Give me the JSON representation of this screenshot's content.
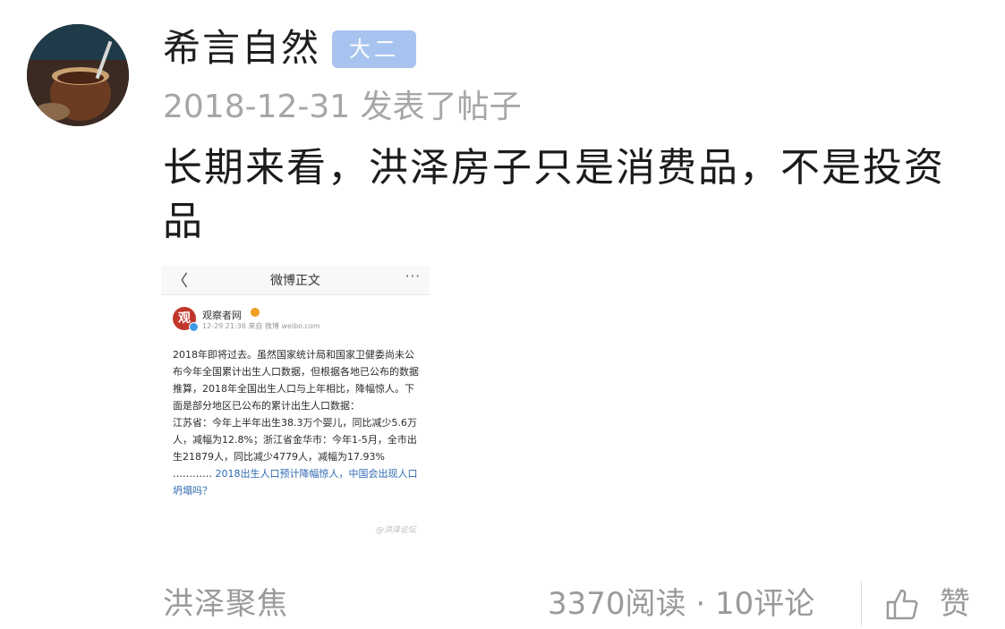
{
  "post": {
    "author": "希言自然",
    "badge": "大二",
    "meta": "2018-12-31 发表了帖子",
    "title": "长期来看，洪泽房子只是消费品，不是投资品"
  },
  "screenshot": {
    "header_title": "微博正文",
    "back_glyph": "〈",
    "more_glyph": "···",
    "account_logo_text": "观",
    "account_name": "观察者网",
    "account_time": "12-29 21:36 来自 微博 weibo.com",
    "body_text": "2018年即将过去。虽然国家统计局和国家卫健委尚未公布今年全国累计出生人口数据，但根据各地已公布的数据推算，2018年全国出生人口与上年相比，降幅惊人。下面是部分地区已公布的累计出生人口数据：",
    "body_text_2": "江苏省：今年上半年出生38.3万个婴儿，同比减少5.6万人，减幅为12.8%；浙江省金华市：今年1-5月，全市出生21879人，同比减少4779人，减幅为17.93%",
    "ellipsis": "…………",
    "link_text": "2018出生人口预计降幅惊人，中国会出现人口坍塌吗？",
    "watermark": "@洪泽论坛"
  },
  "footer": {
    "forum": "洪泽聚焦",
    "stats": "3370阅读 · 10评论",
    "like_label": "赞"
  },
  "icons": {
    "like": "thumbs-up-icon"
  },
  "colors": {
    "badge_bg": "#a8c3ef",
    "link": "#2f6ab0",
    "muted": "#9a9a9a"
  }
}
